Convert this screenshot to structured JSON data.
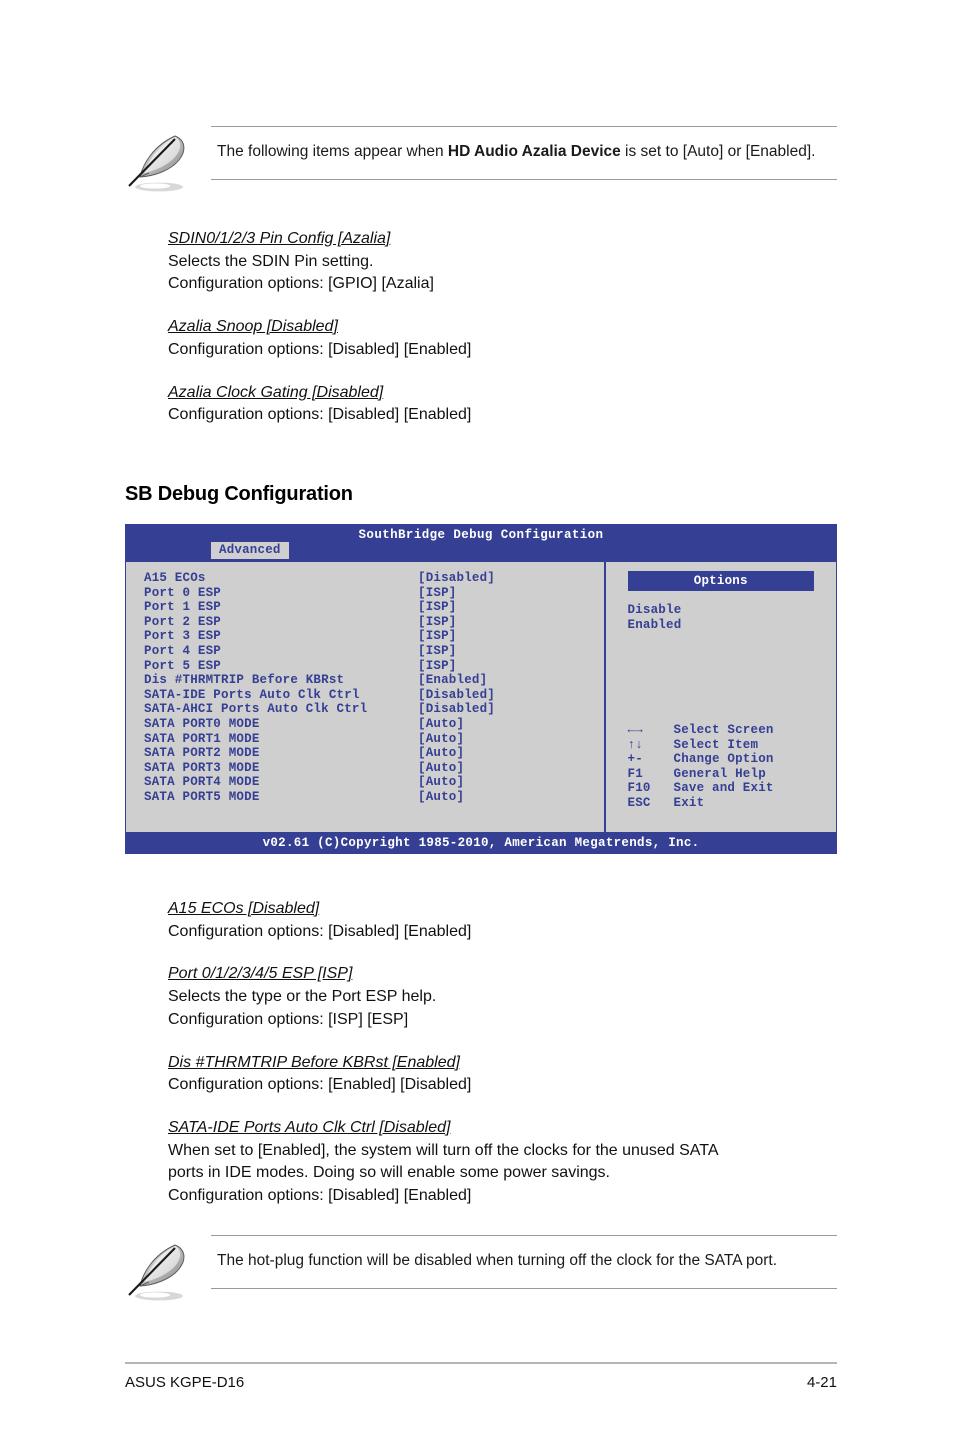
{
  "notes": [
    {
      "icon": "feather-note-icon",
      "text_before": "The following items appear when ",
      "text_bold": "HD Audio Azalia Device",
      "text_after": " is set to [Auto] or [Enabled]."
    },
    {
      "icon": "feather-note-icon",
      "text": "The hot-plug function will be disabled when turning off the clock for the SATA port."
    }
  ],
  "upper_sections": [
    {
      "title": "SDIN0/1/2/3 Pin Config [Azalia]",
      "lines": [
        "Selects the SDIN Pin setting.",
        "Configuration options: [GPIO] [Azalia]"
      ]
    },
    {
      "title": "Azalia Snoop [Disabled]",
      "lines": [
        "Configuration options: [Disabled] [Enabled]"
      ]
    },
    {
      "title": "Azalia Clock Gating [Disabled]",
      "lines": [
        "Configuration options: [Disabled] [Enabled]"
      ]
    }
  ],
  "section_heading": "SB Debug Configuration",
  "bios": {
    "title": "SouthBridge Debug Configuration",
    "tab": "Advanced",
    "rows": [
      {
        "label": "A15 ECOs",
        "value": "[Disabled]"
      },
      {
        "label": "Port 0 ESP",
        "value": "[ISP]"
      },
      {
        "label": "Port 1 ESP",
        "value": "[ISP]"
      },
      {
        "label": "Port 2 ESP",
        "value": "[ISP]"
      },
      {
        "label": "Port 3 ESP",
        "value": "[ISP]"
      },
      {
        "label": "Port 4 ESP",
        "value": "[ISP]"
      },
      {
        "label": "Port 5 ESP",
        "value": "[ISP]"
      },
      {
        "label": "Dis #THRMTRIP Before KBRst",
        "value": "[Enabled]"
      },
      {
        "label": "SATA-IDE Ports Auto Clk Ctrl",
        "value": "[Disabled]"
      },
      {
        "label": "SATA-AHCI Ports Auto Clk Ctrl",
        "value": "[Disabled]"
      },
      {
        "label": "SATA PORT0 MODE",
        "value": "[Auto]"
      },
      {
        "label": "SATA PORT1 MODE",
        "value": "[Auto]"
      },
      {
        "label": "SATA PORT2 MODE",
        "value": "[Auto]"
      },
      {
        "label": "SATA PORT3 MODE",
        "value": "[Auto]"
      },
      {
        "label": "SATA PORT4 MODE",
        "value": "[Auto]"
      },
      {
        "label": "SATA PORT5 MODE",
        "value": "[Auto]"
      }
    ],
    "options_header": "Options",
    "options": [
      "Disable",
      "Enabled"
    ],
    "legend": [
      {
        "key": "←→",
        "action": "Select Screen"
      },
      {
        "key": "↑↓",
        "action": "Select Item"
      },
      {
        "key": "+-",
        "action": "Change Option"
      },
      {
        "key": "F1",
        "action": "General Help"
      },
      {
        "key": "F10",
        "action": "Save and Exit"
      },
      {
        "key": "ESC",
        "action": "Exit"
      }
    ],
    "footer": "v02.61 (C)Copyright 1985-2010, American Megatrends, Inc.",
    "colors": {
      "chrome_blue": "#353f93",
      "panel_gray": "#cfcfcf",
      "text_white": "#ffffff"
    }
  },
  "lower_sections": [
    {
      "title": "A15 ECOs [Disabled]",
      "lines": [
        "Configuration options: [Disabled] [Enabled]"
      ]
    },
    {
      "title": "Port 0/1/2/3/4/5 ESP [ISP]",
      "lines": [
        "Selects the type or the Port ESP help.",
        "Configuration options: [ISP] [ESP]"
      ]
    },
    {
      "title": "Dis #THRMTRIP Before KBRst [Enabled]",
      "lines": [
        "Configuration options: [Enabled] [Disabled]"
      ]
    },
    {
      "title": "SATA-IDE Ports Auto Clk Ctrl [Disabled]",
      "lines": [
        "When set to [Enabled], the system will turn off the clocks for the unused SATA",
        "ports in IDE modes. Doing so will enable some power savings.",
        "Configuration options: [Disabled] [Enabled]"
      ]
    }
  ],
  "footer": {
    "product": "ASUS KGPE-D16",
    "page_number": "4-21"
  }
}
